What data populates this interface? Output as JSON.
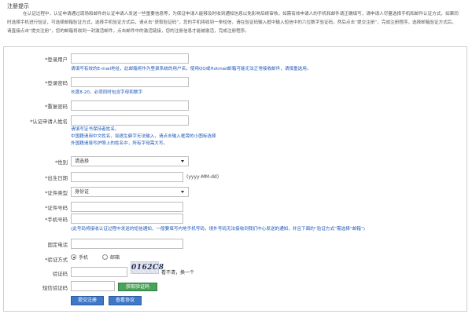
{
  "tip": {
    "title": "注册提示",
    "text": "在认证过程中，认证申请通过现场和邮件的认证申请人发送一些重要信息等，为保证申请人能够及时收到通知信息以免影响后续审核，如需有效申请人的手机和邮件请正确填写，请申请人尽量选择手机和邮件认证方式，如果同时选择手机进行验证，可选择邮箱验证方式，选择手机验证方式后，请点击“获取验证码”，您的手机将收到一条短信，请在验证码输入框中输入短信中的六位数字验证码，然后点击“提交注册”，完成注册程序，选择邮箱验证方式后，请直接点击“提交注册”，您的邮箱将收到一封激活邮件，点击邮件中的激活链接，您的注册信息才能被激活，完成注册程序。"
  },
  "form": {
    "login_user": {
      "label": "*登录用户",
      "hint": "请填写有效的E-mail地址，此邮箱将作为登录系统的用户名，使用QQ或Hotmail邮箱可能无法正常接收邮件，请慎重选用。"
    },
    "login_password": {
      "label": "*登录密码",
      "hint": "长度8-20，必须同时包含字母和数字"
    },
    "confirm_password": {
      "label": "*重复密码"
    },
    "applicant_name": {
      "label": "*认证申请人姓名",
      "hint1": "请填写证书保持者姓名。",
      "hint2": "中国籍请用中文姓名，如遇生僻字无法输入，请点击输入框旁的小图标选择",
      "hint3": "外国籍请填写护照上的姓名中，所有字母需大写。"
    },
    "gender": {
      "label": "*性别",
      "selected": "请选择"
    },
    "birth_date": {
      "label": "*出生日期",
      "format": "(yyyy-MM-dd)"
    },
    "id_type": {
      "label": "*证件类型",
      "selected": "身份证"
    },
    "id_number": {
      "label": "*证件号码"
    },
    "mobile": {
      "label": "*手机号码",
      "hint": "(此号码将接收认证过程中发送的短信通知，一般要填写内地手机号码，境外号码无法接收到我们中心发送的通知，并且下面的“验证方式”需选择“邮箱”)"
    },
    "landline": {
      "label": "固定电话"
    },
    "verify_method": {
      "label": "*验证方式",
      "options": [
        "手机",
        "邮箱"
      ],
      "selected_index": 0
    },
    "captcha": {
      "label": "验证码",
      "image_text": "0162C8",
      "note": "看不清，换一个"
    },
    "sms_code": {
      "label": "短信验证码",
      "button": "获取验证码"
    },
    "buttons": {
      "submit": "提交注册",
      "agreement": "查看协议"
    }
  },
  "colors": {
    "hint_blue": "#1a56b5",
    "required_red": "#d00000",
    "button_blue": "#3f78c9",
    "button_green": "#4aa35a"
  }
}
